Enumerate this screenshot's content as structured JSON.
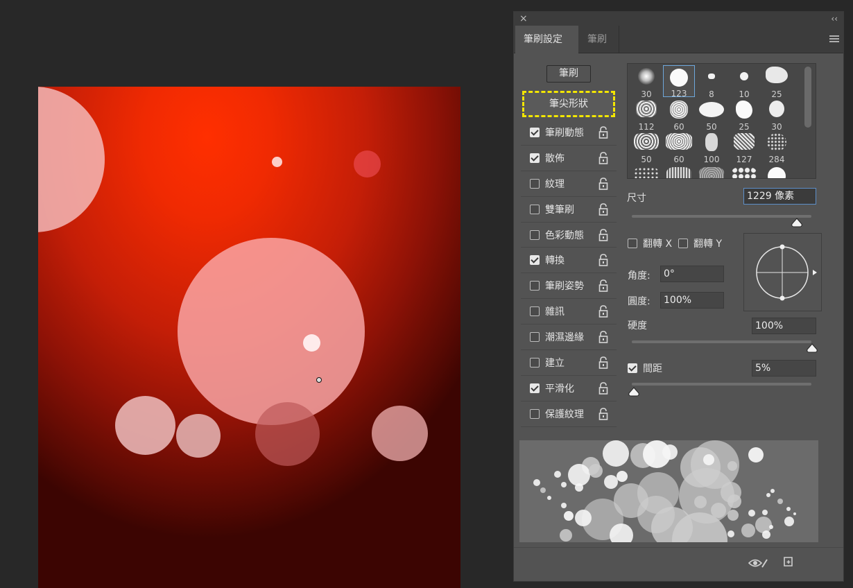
{
  "panel": {
    "close": "×",
    "collapse": "‹‹",
    "tabs": [
      {
        "label": "筆刷設定",
        "active": true
      },
      {
        "label": "筆刷",
        "active": false
      }
    ]
  },
  "sidebar": {
    "brush_button": "筆刷",
    "tip_shape": "筆尖形狀",
    "options": [
      {
        "label": "筆刷動態",
        "checked": true
      },
      {
        "label": "散佈",
        "checked": true
      },
      {
        "label": "紋理",
        "checked": false
      },
      {
        "label": "雙筆刷",
        "checked": false
      },
      {
        "label": "色彩動態",
        "checked": false
      },
      {
        "label": "轉換",
        "checked": true
      },
      {
        "label": "筆刷姿勢",
        "checked": false
      },
      {
        "label": "雜訊",
        "checked": false
      },
      {
        "label": "潮濕邊緣",
        "checked": false
      },
      {
        "label": "建立",
        "checked": false
      },
      {
        "label": "平滑化",
        "checked": true
      },
      {
        "label": "保護紋理",
        "checked": false
      }
    ]
  },
  "presets": [
    {
      "size": "30"
    },
    {
      "size": "123"
    },
    {
      "size": "8"
    },
    {
      "size": "10"
    },
    {
      "size": "25"
    },
    {
      "size": "112"
    },
    {
      "size": "60"
    },
    {
      "size": "50"
    },
    {
      "size": "25"
    },
    {
      "size": "30"
    },
    {
      "size": "50"
    },
    {
      "size": "60"
    },
    {
      "size": "100"
    },
    {
      "size": "127"
    },
    {
      "size": "284"
    }
  ],
  "settings": {
    "size_label": "尺寸",
    "size_value": "1229 像素",
    "flip_x_label": "翻轉 X",
    "flip_y_label": "翻轉 Y",
    "angle_label": "角度:",
    "angle_value": "0°",
    "roundness_label": "圓度:",
    "roundness_value": "100%",
    "hardness_label": "硬度",
    "hardness_value": "100%",
    "spacing_label": "間距",
    "spacing_value": "5%",
    "spacing_checked": true,
    "size_slider_level": 0.95,
    "hardness_slider_level": 1.0,
    "spacing_slider_level": 0.0
  },
  "icons": {
    "eye": "eye-brush-icon",
    "new": "new-preset-icon",
    "lock": "lock-icon",
    "menu": "panel-menu-icon"
  },
  "colors": {
    "canvas_center": "#ff2f00",
    "canvas_edge": "#3c0502",
    "highlight": "#f3e600",
    "selection": "#6ea8dc"
  }
}
